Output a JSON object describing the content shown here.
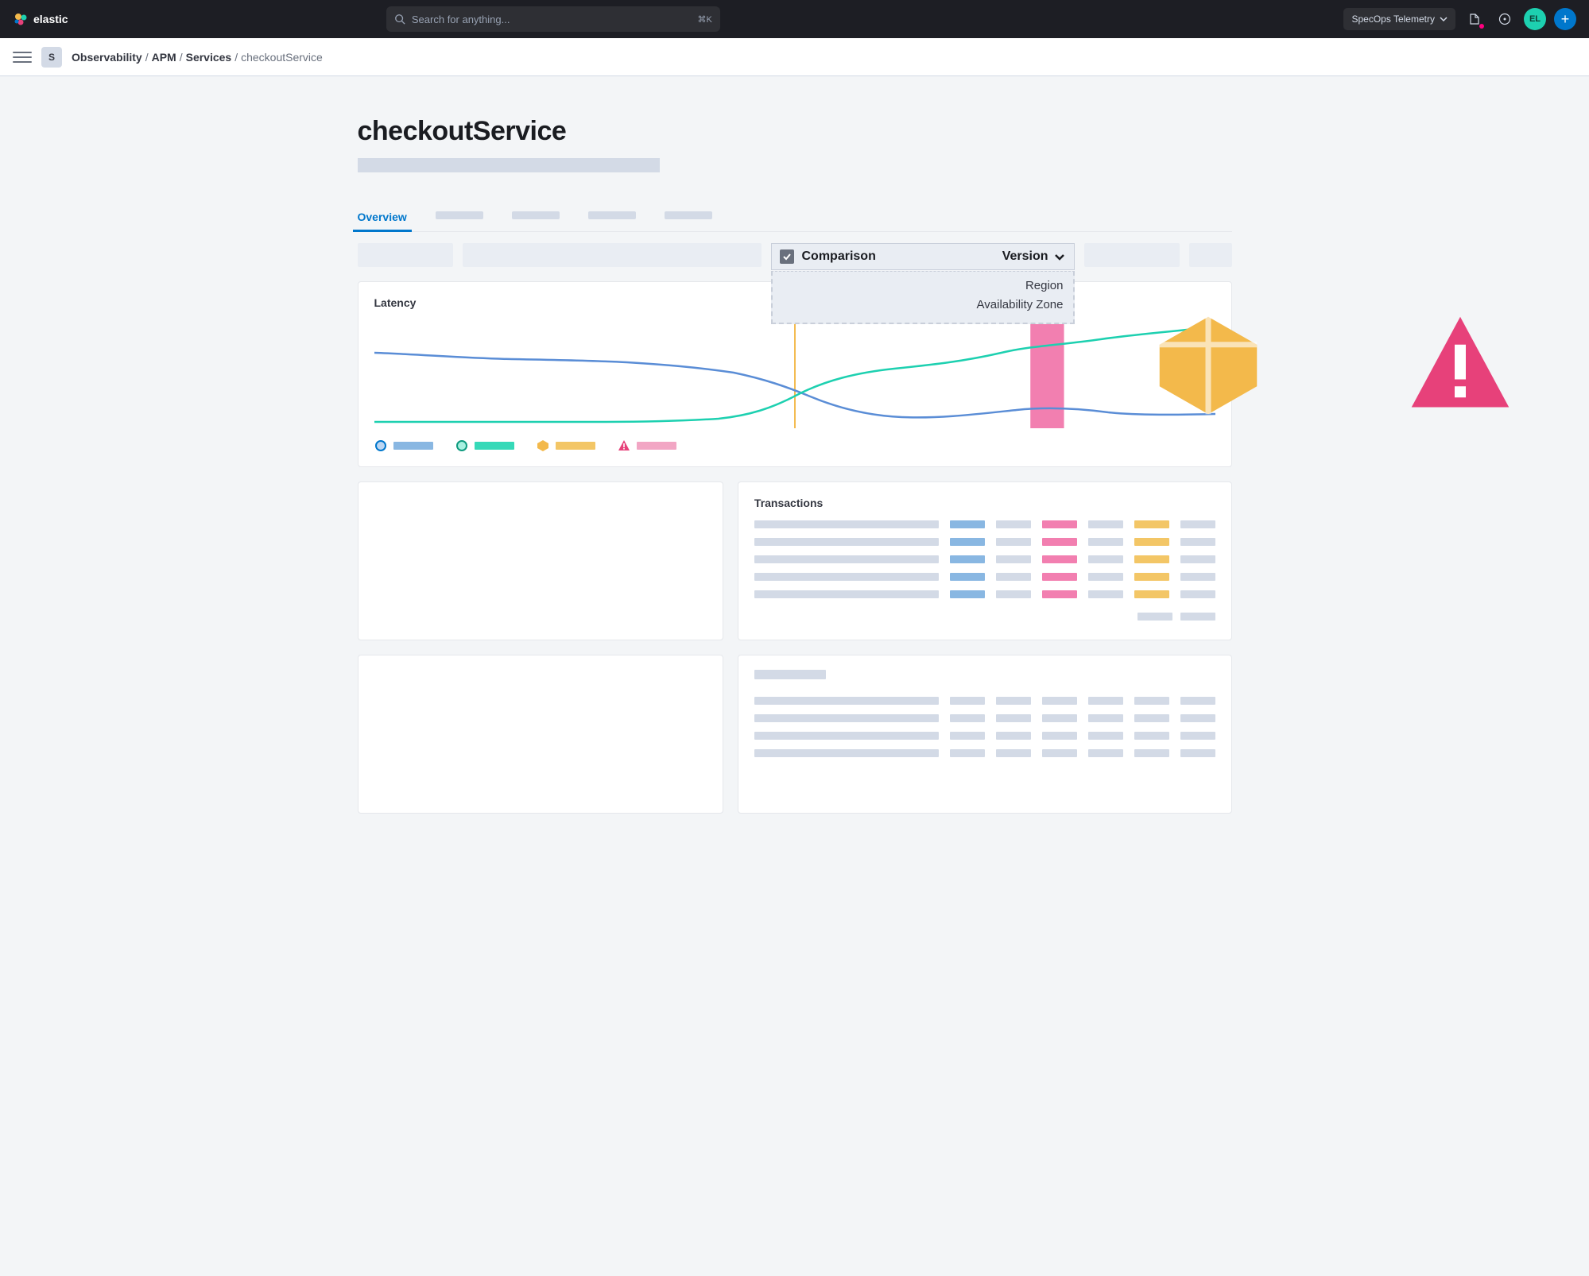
{
  "header": {
    "brand": "elastic",
    "search_placeholder": "Search for anything...",
    "search_shortcut": "⌘K",
    "deployment": "SpecOps Telemetry",
    "avatar_initials": "EL"
  },
  "breadcrumb": {
    "badge": "S",
    "parts": [
      "Observability",
      "APM",
      "Services"
    ],
    "current": "checkoutService"
  },
  "page": {
    "title": "checkoutService"
  },
  "tabs": {
    "active": "Overview"
  },
  "comparison": {
    "label": "Comparison",
    "selected": "Version",
    "options": [
      "Region",
      "Availability Zone"
    ]
  },
  "latency": {
    "title": "Latency",
    "legend_colors": {
      "series_a": "#5a8dd6",
      "series_b": "#1dd0b0",
      "series_c": "#f3b94b",
      "series_d": "#e7417a"
    }
  },
  "transactions": {
    "title": "Transactions"
  },
  "chart_data": {
    "type": "line",
    "title": "Latency",
    "xlabel": "",
    "ylabel": "",
    "ylim": [
      0,
      100
    ],
    "x": [
      0,
      5,
      10,
      15,
      20,
      25,
      30,
      35,
      40,
      45,
      50,
      55,
      60,
      65,
      70,
      75,
      80,
      85,
      90,
      95,
      100
    ],
    "series": [
      {
        "name": "blue",
        "color": "#5a8dd6",
        "values": [
          68,
          66,
          63,
          62,
          60,
          60,
          58,
          55,
          52,
          48,
          42,
          34,
          22,
          12,
          8,
          10,
          14,
          16,
          14,
          12,
          12
        ]
      },
      {
        "name": "green",
        "color": "#1dd0b0",
        "values": [
          6,
          6,
          6,
          6,
          6,
          6,
          6,
          6,
          6,
          8,
          16,
          32,
          44,
          52,
          54,
          60,
          68,
          72,
          78,
          82,
          88
        ]
      }
    ],
    "markers": [
      {
        "type": "deploy",
        "x": 50,
        "color": "#f3b94b"
      },
      {
        "type": "alert",
        "x_start": 78,
        "x_end": 82,
        "color": "#f27fb0"
      }
    ]
  }
}
